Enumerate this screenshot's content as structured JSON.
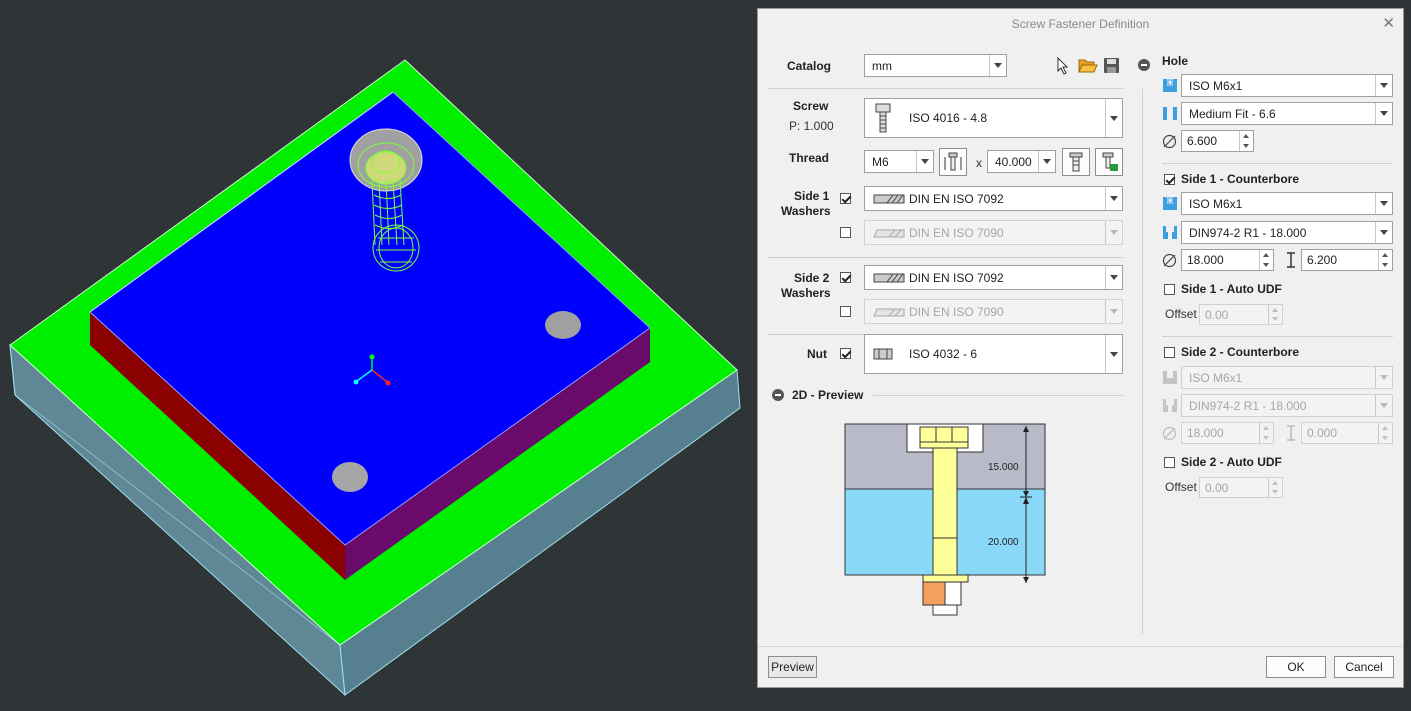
{
  "dialog": {
    "title": "Screw Fastener Definition",
    "close_symbol": "✕",
    "catalog": {
      "label": "Catalog",
      "value": "mm"
    },
    "screw": {
      "label": "Screw",
      "pitch": "P: 1.000",
      "value": "ISO 4016 - 4.8"
    },
    "thread": {
      "label": "Thread",
      "size": "M6",
      "times": "x",
      "length": "40.000"
    },
    "side1_washers": {
      "label_line1": "Side 1",
      "label_line2": "Washers",
      "items": [
        {
          "value": "DIN EN ISO 7092",
          "checked": true
        },
        {
          "value": "DIN EN ISO 7090",
          "checked": false
        }
      ]
    },
    "side2_washers": {
      "label_line1": "Side 2",
      "label_line2": "Washers",
      "items": [
        {
          "value": "DIN EN ISO 7092",
          "checked": true
        },
        {
          "value": "DIN EN ISO 7090",
          "checked": false
        }
      ]
    },
    "nut": {
      "label": "Nut",
      "value": "ISO 4032 - 6",
      "checked": true
    },
    "preview_section": {
      "label": "2D - Preview",
      "dim_top": "15.000",
      "dim_bottom": "20.000"
    },
    "hole": {
      "label": "Hole",
      "type": "ISO M6x1",
      "fit": "Medium Fit - 6.6",
      "diameter": "6.600"
    },
    "side1_counterbore": {
      "label": "Side 1 - Counterbore",
      "checked": true,
      "type": "ISO M6x1",
      "standard": "DIN974-2 R1 - 18.000",
      "diameter": "18.000",
      "depth": "6.200"
    },
    "side1_auto_udf": {
      "label": "Side 1 - Auto UDF",
      "checked": false,
      "offset_label": "Offset",
      "offset": "0.00"
    },
    "side2_counterbore": {
      "label": "Side 2 - Counterbore",
      "checked": false,
      "type": "ISO M6x1",
      "standard": "DIN974-2 R1 - 18.000",
      "diameter": "18.000",
      "depth": "0.000"
    },
    "side2_auto_udf": {
      "label": "Side 2 - Auto UDF",
      "checked": false,
      "offset_label": "Offset",
      "offset": "0.00"
    },
    "buttons": {
      "preview": "Preview",
      "ok": "OK",
      "cancel": "Cancel"
    }
  },
  "icons": [
    "select-pointer-icon",
    "open-folder-icon",
    "save-disk-icon",
    "screw-thumbnail-icon",
    "thread-length-icon",
    "screw-options-icon",
    "screw-placement-icon",
    "washer-thumbnail-icon",
    "nut-thumbnail-icon",
    "hole-type-icon",
    "hole-fit-icon",
    "diameter-icon",
    "counterbore-type-icon",
    "counterbore-standard-icon",
    "depth-icon"
  ],
  "colors": {
    "viewport_bg": "#2f3437",
    "base_plate": "#00ee00",
    "base_side": "#5f8796",
    "top_plate": "#0000ff",
    "top_side_left": "#8b0000",
    "top_side_right": "#6a0a6a",
    "screw_wire": "#7cff3a",
    "preview_upper": "#b8bac8",
    "preview_lower": "#8ad8f8",
    "preview_screw": "#ffff99",
    "preview_nut": "#f4a060"
  }
}
